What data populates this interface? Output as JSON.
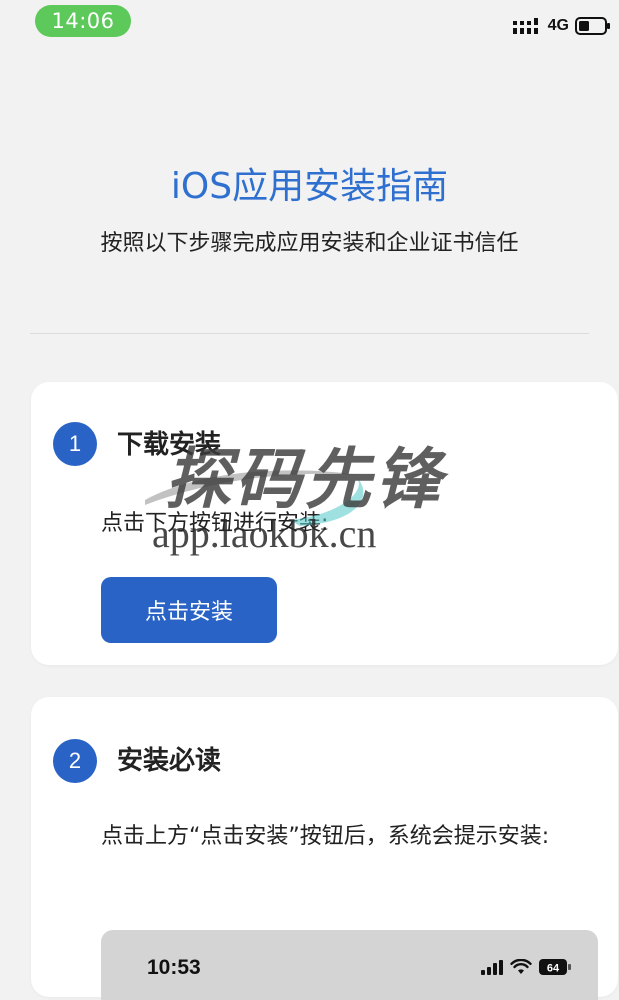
{
  "status_bar": {
    "time": "14:06",
    "network": "4G"
  },
  "header": {
    "title": "iOS应用安装指南",
    "subtitle": "按照以下步骤完成应用安装和企业证书信任"
  },
  "steps": [
    {
      "number": "1",
      "title": "下载安装",
      "description": "点击下方按钮进行安装:",
      "button_label": "点击安装"
    },
    {
      "number": "2",
      "title": "安装必读",
      "description": "点击上方“点击安装”按钮后，系统会提示安装:"
    }
  ],
  "preview": {
    "time": "10:53",
    "battery": "64"
  },
  "watermark": {
    "text": "探码先锋",
    "url": "app.laokbk.cn"
  },
  "colors": {
    "accent": "#2a63c6",
    "title_blue": "#2f6fd0",
    "time_pill_green": "#5cc95a",
    "background": "#f2f2f2"
  }
}
